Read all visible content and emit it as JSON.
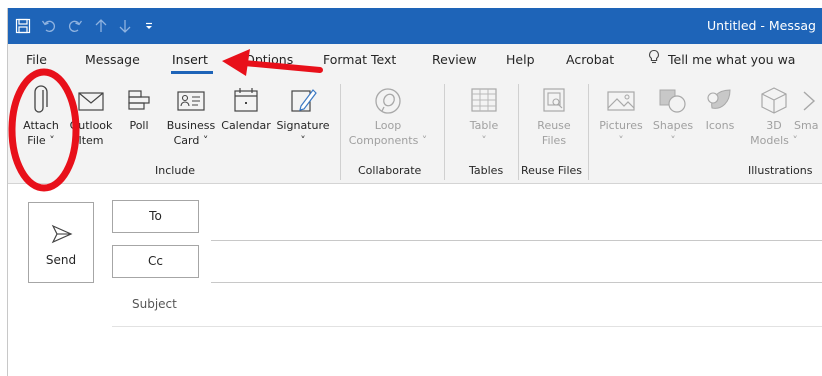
{
  "window": {
    "title": "Untitled  -  Messag"
  },
  "tabs": [
    {
      "label": "File"
    },
    {
      "label": "Message"
    },
    {
      "label": "Insert"
    },
    {
      "label": "Options"
    },
    {
      "label": "Format Text"
    },
    {
      "label": "Review"
    },
    {
      "label": "Help"
    },
    {
      "label": "Acrobat"
    }
  ],
  "tell_me": {
    "text": "Tell me what you wa"
  },
  "ribbon": {
    "include": {
      "label": "Include",
      "attach_file": {
        "line1": "Attach",
        "line2": "File ˅"
      },
      "outlook_item": {
        "line1": "Outlook",
        "line2": "Item"
      },
      "poll": {
        "line1": "Poll"
      },
      "business_card": {
        "line1": "Business",
        "line2": "Card ˅"
      },
      "calendar": {
        "line1": "Calendar"
      },
      "signature": {
        "line1": "Signature",
        "line2": "˅"
      }
    },
    "collaborate": {
      "label": "Collaborate",
      "loop": {
        "line1": "Loop",
        "line2": "Components ˅"
      }
    },
    "tables": {
      "label": "Tables",
      "table": {
        "line1": "Table",
        "line2": "˅"
      }
    },
    "reuse_files": {
      "label": "Reuse Files",
      "reuse": {
        "line1": "Reuse",
        "line2": "Files"
      }
    },
    "illustrations": {
      "label": "Illustrations",
      "pictures": {
        "line1": "Pictures",
        "line2": "˅"
      },
      "shapes": {
        "line1": "Shapes",
        "line2": "˅"
      },
      "icons": {
        "line1": "Icons"
      },
      "models": {
        "line1": "3D",
        "line2": "Models ˅"
      },
      "smart": {
        "line1": "Sma"
      }
    }
  },
  "compose": {
    "send_label": "Send",
    "to_label": "To",
    "cc_label": "Cc",
    "subject_label": "Subject"
  },
  "colors": {
    "title_bar": "#1e64b8",
    "annotation_red": "#e8101a"
  }
}
